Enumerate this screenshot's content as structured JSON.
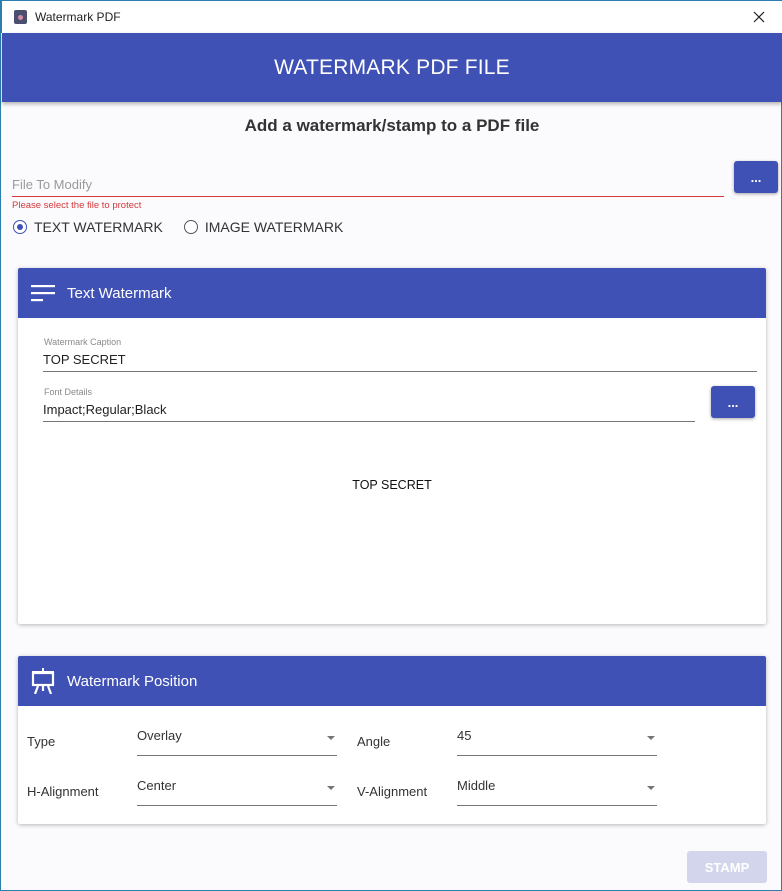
{
  "window": {
    "title": "Watermark PDF",
    "close_icon": "close-icon"
  },
  "appbar": {
    "title": "WATERMARK PDF FILE"
  },
  "subtitle": "Add a watermark/stamp to a PDF file",
  "file": {
    "placeholder": "File To Modify",
    "value": "",
    "error": "Please select the file to protect",
    "browse_label": "..."
  },
  "mode": {
    "options": [
      {
        "label": "TEXT WATERMARK",
        "checked": true
      },
      {
        "label": "IMAGE WATERMARK",
        "checked": false
      }
    ]
  },
  "text_card": {
    "title": "Text Watermark",
    "icon": "text-lines-icon",
    "caption_label": "Watermark Caption",
    "caption_value": "TOP SECRET",
    "font_label": "Font Details",
    "font_value": "Impact;Regular;Black",
    "font_button_label": "...",
    "preview_text": "TOP SECRET"
  },
  "position_card": {
    "title": "Watermark Position",
    "icon": "presentation-easel-icon",
    "fields": {
      "type": {
        "label": "Type",
        "value": "Overlay"
      },
      "angle": {
        "label": "Angle",
        "value": "45"
      },
      "h_alignment": {
        "label": "H-Alignment",
        "value": "Center"
      },
      "v_alignment": {
        "label": "V-Alignment",
        "value": "Middle"
      }
    }
  },
  "actions": {
    "stamp_label": "STAMP",
    "stamp_enabled": false
  },
  "colors": {
    "primary": "#3f51b5",
    "error": "#d33a3a",
    "disabled_button": "#d3d5ec"
  }
}
